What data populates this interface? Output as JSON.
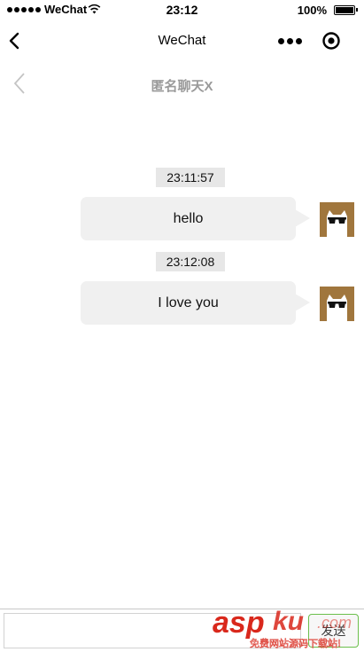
{
  "status_bar": {
    "carrier": "WeChat",
    "time": "23:12",
    "battery": "100%"
  },
  "nav": {
    "title": "WeChat",
    "back_icon": "chevron-left-icon",
    "more_icon": "more-dots-icon",
    "close_icon": "target-close-icon"
  },
  "chat": {
    "title": "匿名聊天X",
    "back_icon": "chevron-left-icon",
    "messages": [
      {
        "timestamp": "23:11:57",
        "text": "hello",
        "avatar": "cat-sunglasses-avatar"
      },
      {
        "timestamp": "23:12:08",
        "text": "I love you",
        "avatar": "cat-sunglasses-avatar"
      }
    ]
  },
  "input": {
    "value": "",
    "placeholder": "",
    "send_label": "发送"
  },
  "watermark": {
    "logo": "asp ku .com",
    "tagline": "免费网站源码下载站!"
  },
  "colors": {
    "bubble": "#f0f0f0",
    "timestamp_bg": "#e7e7e7",
    "avatar_bg": "#a0763d",
    "send_border": "#6bbf4c",
    "watermark_red": "#d9281c"
  }
}
